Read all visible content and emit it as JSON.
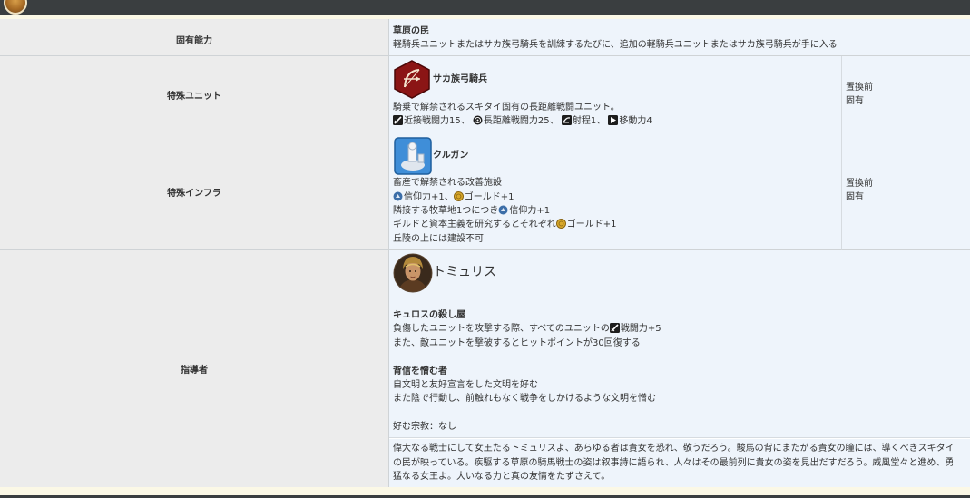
{
  "rows": {
    "ability": {
      "label": "固有能力",
      "name": "草原の民",
      "desc": "軽騎兵ユニットまたはサカ族弓騎兵を訓練するたびに、追加の軽騎兵ユニットまたはサカ族弓騎兵が手に入る"
    },
    "unit": {
      "label": "特殊ユニット",
      "name": "サカ族弓騎兵",
      "desc": "騎乗で解禁されるスキタイ固有の長距離戦闘ユニット。",
      "stats": [
        "近接戦闘力15、",
        "長距離戦闘力25、",
        "射程1、",
        "移動力4"
      ],
      "replaced_label": "置換前",
      "replaced_value": "固有"
    },
    "infra": {
      "label": "特殊インフラ",
      "name": "クルガン",
      "lines": [
        "畜産で解禁される改善施設",
        "信仰力+1、",
        "ゴールド+1",
        "隣接する牧草地1つにつき",
        "信仰力+1",
        "ギルドと資本主義を研究するとそれぞれ",
        "ゴールド+1",
        "丘陵の上には建設不可"
      ],
      "replaced_label": "置換前",
      "replaced_value": "固有"
    },
    "leader": {
      "label": "指導者",
      "name": "トミュリス",
      "ability1_title": "キュロスの殺し屋",
      "ability1_line1a": "負傷したユニットを攻撃する際、すべてのユニットの",
      "ability1_line1b": "戦闘力+5",
      "ability1_line2": "また、敵ユニットを撃破するとヒットポイントが30回復する",
      "ability2_title": "背信を憎む者",
      "ability2_line1": "自文明と友好宣言をした文明を好む",
      "ability2_line2": "また陰で行動し、前触れもなく戦争をしかけるような文明を憎む",
      "religion": "好む宗教：なし",
      "quote": [
        "偉大なる戦士にして女王たるトミュリスよ、あらゆる者は貴女を恐れ、敬うだろう。駿馬の背にまたがる貴女の瞳には、導くべきスキタイ",
        "の民が映っている。疾駆する草原の騎馬戦士の姿は叙事詩に語られ、人々はその最前列に貴女の姿を見出だすだろう。威風堂々と進め、勇",
        "猛なる女王よ。大いなる力と真の友情をたずさえて。"
      ]
    }
  },
  "colors": {
    "unit_badge": "#8b1515",
    "infra_badge": "#3f8ed8",
    "topbar": "#3a3e40"
  }
}
